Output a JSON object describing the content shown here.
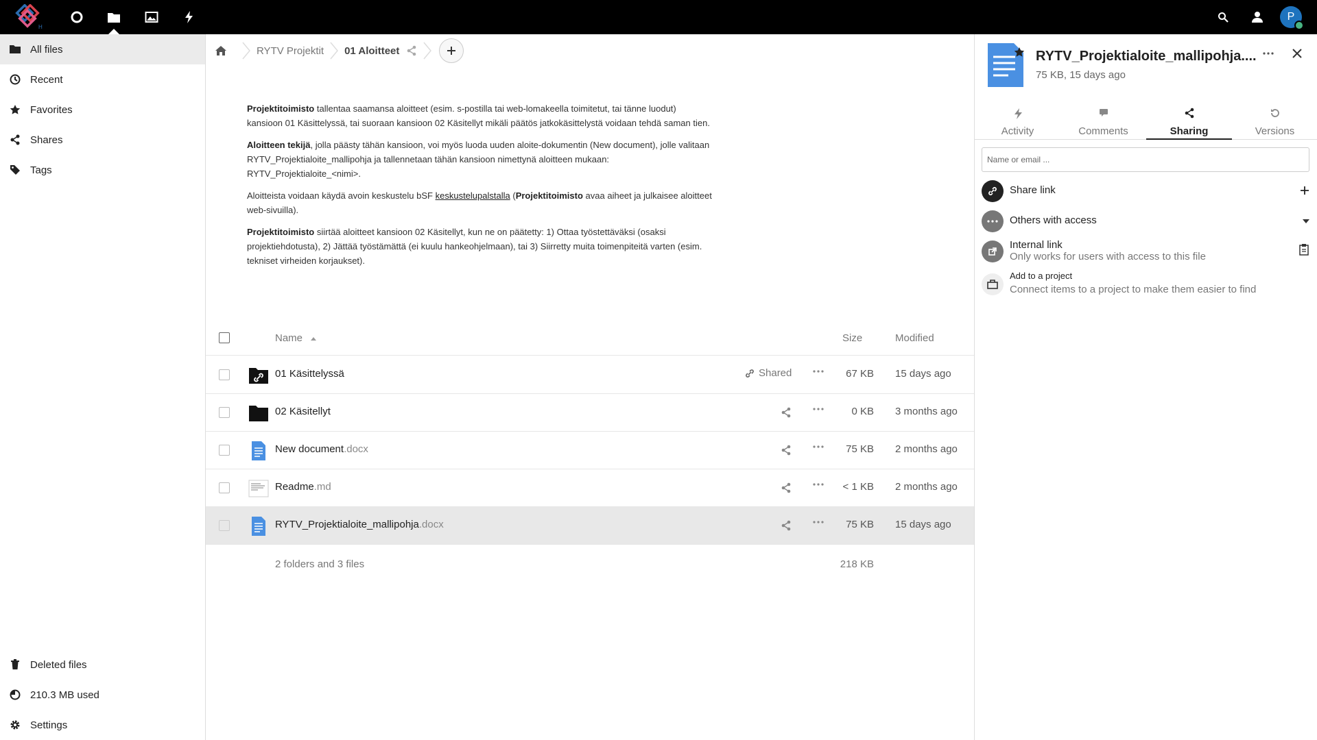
{
  "topbar": {
    "apps": [
      {
        "name": "dashboard",
        "icon": "circle-icon"
      },
      {
        "name": "files",
        "icon": "folder-icon",
        "active": true
      },
      {
        "name": "photos",
        "icon": "image-icon"
      },
      {
        "name": "activity",
        "icon": "lightning-icon"
      }
    ],
    "avatar_initial": "P"
  },
  "nav": {
    "items": [
      {
        "label": "All files",
        "icon": "folder-icon",
        "active": true
      },
      {
        "label": "Recent",
        "icon": "clock-icon"
      },
      {
        "label": "Favorites",
        "icon": "star-icon"
      },
      {
        "label": "Shares",
        "icon": "share-icon"
      },
      {
        "label": "Tags",
        "icon": "tag-icon"
      }
    ],
    "bottom": [
      {
        "label": "Deleted files",
        "icon": "trash-icon"
      },
      {
        "label": "210.3 MB used",
        "icon": "pie-icon"
      },
      {
        "label": "Settings",
        "icon": "gear-icon"
      }
    ]
  },
  "breadcrumb": {
    "items": [
      "RYTV Projektit",
      "01 Aloitteet"
    ]
  },
  "readme": {
    "p1_b": "Projektitoimisto",
    "p1_t": " tallentaa saamansa aloitteet (esim. s-postilla tai web-lomakeella toimitetut, tai tänne luodut) kansioon 01 Käsittelyssä, tai suoraan kansioon 02 Käsitellyt mikäli päätös jatkokäsittelystä voidaan tehdä saman tien.",
    "p2_b": "Aloitteen tekijä",
    "p2_t": ", jolla päästy tähän kansioon, voi myös luoda uuden aloite-dokumentin (New document), jolle valitaan RYTV_Projektialoite_mallipohja ja tallennetaan tähän kansioon nimettynä aloitteen mukaan: RYTV_Projektialoite_<nimi>.",
    "p3_t1": "Aloitteista voidaan käydä avoin keskustelu bSF ",
    "p3_link": "keskustelupalstalla",
    "p3_t2": " (",
    "p3_b": "Projektitoimisto",
    "p3_t3": " avaa aiheet ja julkaisee aloitteet web-sivuilla).",
    "p4_b": "Projektitoimisto",
    "p4_t": " siirtää aloitteet kansioon 02 Käsitellyt, kun ne on päätetty: 1) Ottaa työstettäväksi (osaksi projektiehdotusta), 2) Jättää työstämättä (ei kuulu hankeohjelmaan), tai 3) Siirretty muita toimenpiteitä varten (esim. tekniset virheiden korjaukset)."
  },
  "table": {
    "headers": {
      "name": "Name",
      "size": "Size",
      "modified": "Modified"
    },
    "rows": [
      {
        "name": "01 Käsittelyssä",
        "ext": "",
        "type": "shared-folder",
        "shared_label": "Shared",
        "size": "67 KB",
        "modified": "15 days ago"
      },
      {
        "name": "02 Käsitellyt",
        "ext": "",
        "type": "folder",
        "size": "0 KB",
        "modified": "3 months ago"
      },
      {
        "name": "New document",
        "ext": ".docx",
        "type": "document",
        "size": "75 KB",
        "modified": "2 months ago"
      },
      {
        "name": "Readme",
        "ext": ".md",
        "type": "text",
        "size": "< 1 KB",
        "modified": "2 months ago"
      },
      {
        "name": "RYTV_Projektialoite_mallipohja",
        "ext": ".docx",
        "type": "document",
        "size": "75 KB",
        "modified": "15 days ago",
        "selected": true
      }
    ],
    "summary": {
      "count": "2 folders and 3 files",
      "total": "218 KB"
    }
  },
  "sidebar": {
    "title": "RYTV_Projektialoite_mallipohja....",
    "subtitle": "75 KB, 15 days ago",
    "tabs": [
      {
        "label": "Activity",
        "icon": "lightning-icon"
      },
      {
        "label": "Comments",
        "icon": "comment-icon"
      },
      {
        "label": "Sharing",
        "icon": "share-icon",
        "active": true
      },
      {
        "label": "Versions",
        "icon": "history-icon"
      }
    ],
    "search_placeholder": "Name or email ...",
    "share_link": "Share link",
    "others_access": "Others with access",
    "internal_link": "Internal link",
    "internal_desc": "Only works for users with access to this file",
    "add_project": "Add to a project",
    "add_project_desc": "Connect items to a project to make them easier to find"
  },
  "colors": {
    "accent": "#1e73be",
    "doc_blue": "#4a90e2",
    "selected_row": "#e8e8e8",
    "topbar": "#000000"
  }
}
